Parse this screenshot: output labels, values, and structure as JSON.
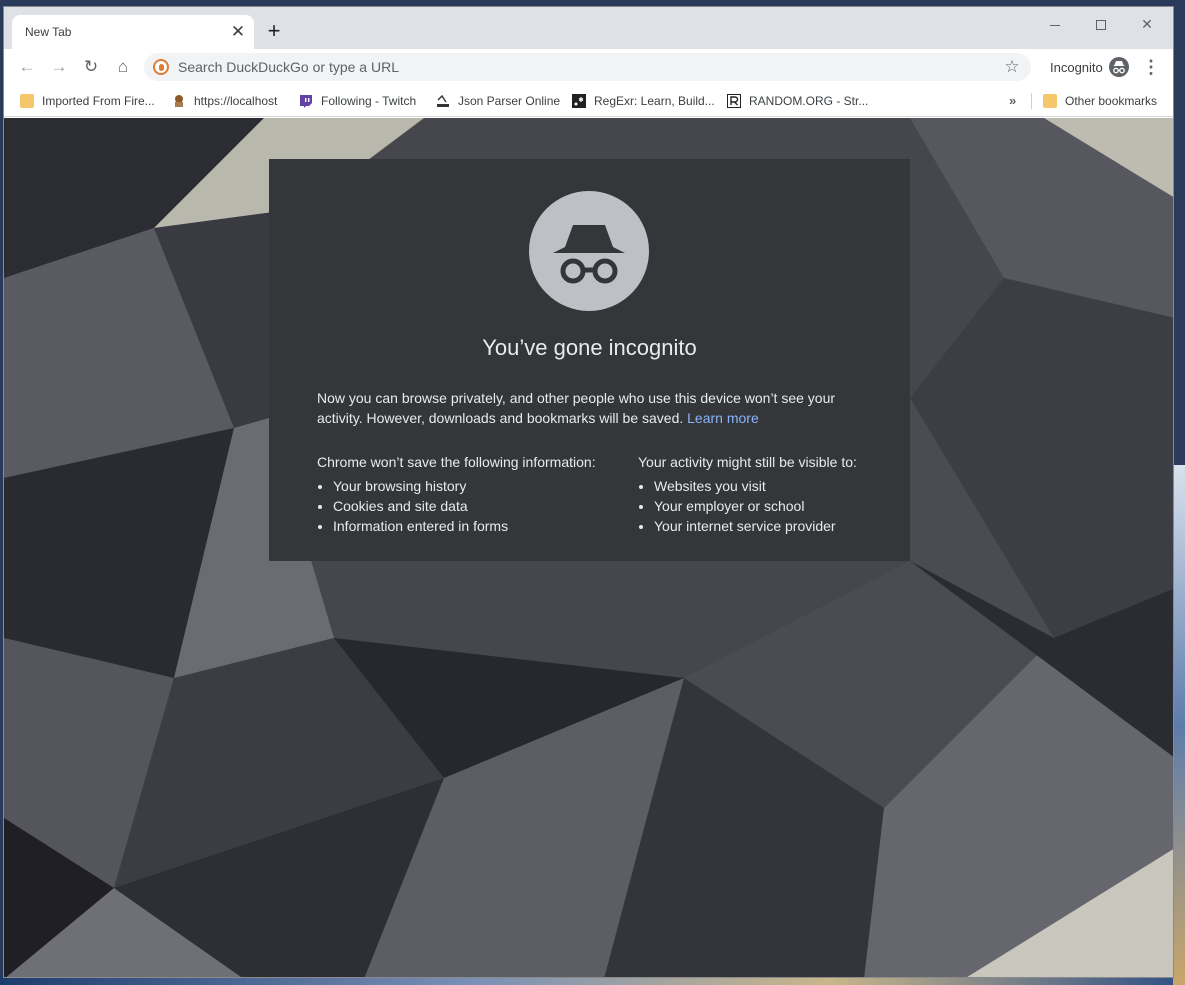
{
  "tab": {
    "title": "New Tab",
    "close_glyph": "✕",
    "new_glyph": "+"
  },
  "window_controls": {
    "minimize": "minimize",
    "maximize": "maximize",
    "close": "✕"
  },
  "toolbar": {
    "back_glyph": "←",
    "forward_glyph": "→",
    "reload_glyph": "↻",
    "home_glyph": "⌂",
    "omnibox_placeholder": "Search DuckDuckGo or type a URL",
    "star_glyph": "☆",
    "profile_label": "Incognito",
    "menu_glyph": "⋮"
  },
  "bookmarks": {
    "items": [
      {
        "label": "Imported From Fire...",
        "icon": "folder-icon"
      },
      {
        "label": "https://localhost",
        "icon": "duck-icon"
      },
      {
        "label": "Following - Twitch",
        "icon": "twitch-icon"
      },
      {
        "label": "Json Parser Online",
        "icon": "json-icon"
      },
      {
        "label": "RegExr: Learn, Build...",
        "icon": "regexr-icon"
      },
      {
        "label": "RANDOM.ORG - Str...",
        "icon": "random-org-icon"
      }
    ],
    "more_glyph": "»",
    "other_label": "Other bookmarks"
  },
  "incognito": {
    "title": "You’ve gone incognito",
    "intro": "Now you can browse privately, and other people who use this device won’t see your activity. However, downloads and bookmarks will be saved.",
    "learn_more": "Learn more",
    "left_heading": "Chrome won’t save the following information:",
    "left_items": [
      "Your browsing history",
      "Cookies and site data",
      "Information entered in forms"
    ],
    "right_heading": "Your activity might still be visible to:",
    "right_items": [
      "Websites you visit",
      "Your employer or school",
      "Your internet service provider"
    ]
  },
  "colors": {
    "tab_strip": "#dee1e6",
    "card_background": "#35363a",
    "card_text": "#e8eaed",
    "link": "#8ab4f8",
    "hero_circle": "#bdc1c6"
  }
}
